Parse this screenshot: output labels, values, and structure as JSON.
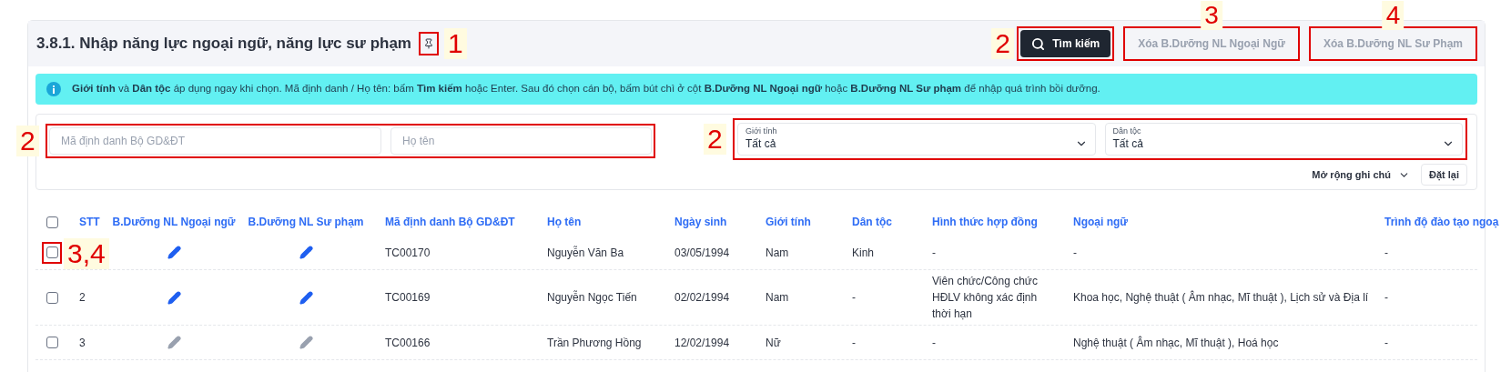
{
  "title": "3.8.1. Nhập năng lực ngoại ngữ, năng lực sư phạm",
  "annotations": {
    "pin": "1",
    "search": "2",
    "clear_foreign": "3",
    "clear_pedagogy": "4",
    "text_fields": "2",
    "selects": "2",
    "row_checkbox": "3,4"
  },
  "buttons": [
    {
      "kind": "search",
      "label": "Tìm kiếm",
      "disabled": false
    },
    {
      "kind": "clear_foreign",
      "label": "Xóa B.Dưỡng NL Ngoại Ngữ",
      "disabled": true
    },
    {
      "kind": "clear_pedagogy",
      "label": "Xóa B.Dưỡng NL Sư Phạm",
      "disabled": true
    }
  ],
  "info": "**Giới tính** và **Dân tộc** áp dụng ngay khi chọn. Mã định danh / Họ tên: bấm **Tìm kiếm** hoặc Enter. Sau đó chọn cán bộ, bấm bút chì ở cột **B.Dưỡng NL Ngoại ngữ** hoặc **B.Dưỡng NL Sư phạm** để nhập quá trình bồi dưỡng.",
  "fields": [
    {
      "placeholder": "Mã định danh Bộ GD&ĐT"
    },
    {
      "placeholder": "Họ tên"
    }
  ],
  "selects": [
    {
      "label": "Giới tính",
      "value": "Tất cả"
    },
    {
      "label": "Dân tộc",
      "value": "Tất cả"
    }
  ],
  "expand_notes": "Mở rộng ghi chú",
  "reset": "Đặt lại",
  "table": {
    "select_all_checked": false,
    "columns": [
      "STT",
      "B.Dưỡng NL Ngoại ngữ",
      "B.Dưỡng NL Sư phạm",
      "Mã định danh Bộ GD&ĐT",
      "Họ tên",
      "Ngày sinh",
      "Giới tính",
      "Dân tộc",
      "Hình thức hợp đồng",
      "Ngoại ngữ",
      "Trình độ đào tạo ngoạ"
    ],
    "rows": [
      {
        "checked": false,
        "edit_enabled": true,
        "cells": [
          "",
          "",
          "",
          "TC00170",
          "Nguyễn Văn Ba",
          "03/05/1994",
          "Nam",
          "Kinh",
          "-",
          "-",
          "-"
        ]
      },
      {
        "checked": false,
        "edit_enabled": true,
        "cells": [
          "2",
          "",
          "",
          "TC00169",
          "Nguyễn Ngọc Tiến",
          "02/02/1994",
          "Nam",
          "-",
          "Viên chức/Công chức HĐLV không xác định thời hạn",
          "Khoa học, Nghệ thuật ( Âm nhạc, Mĩ thuật ), Lịch sử và Địa lí",
          "-"
        ]
      },
      {
        "checked": false,
        "edit_enabled": false,
        "cells": [
          "3",
          "",
          "",
          "TC00166",
          "Trần Phương Hồng",
          "12/02/1994",
          "Nữ",
          "-",
          "-",
          "Nghệ thuật ( Âm nhạc, Mĩ thuật ), Hoá học",
          "-"
        ]
      }
    ]
  }
}
